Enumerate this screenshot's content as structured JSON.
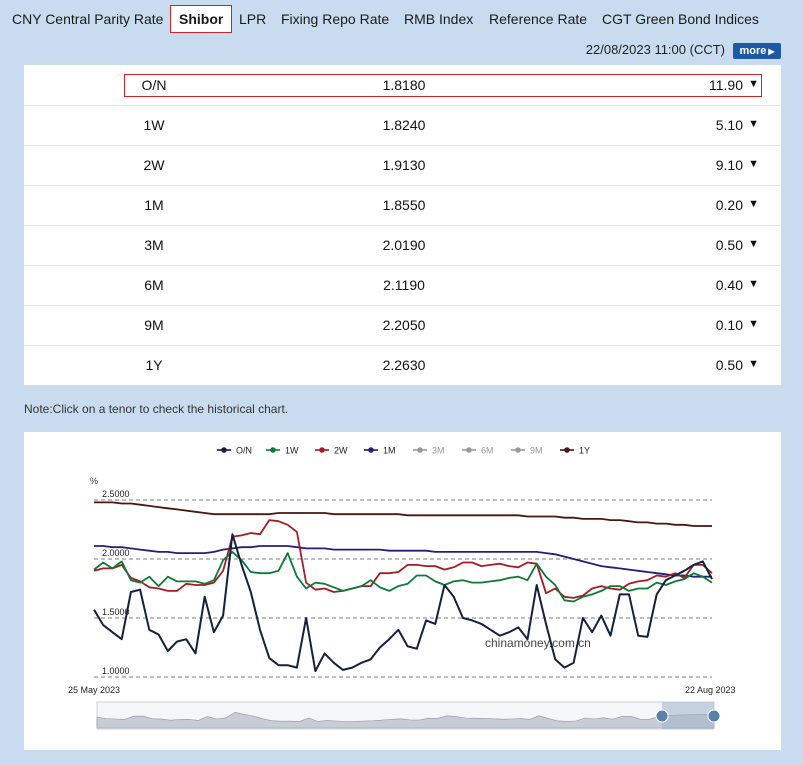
{
  "tabs": [
    {
      "label": "CNY Central Parity Rate",
      "active": false
    },
    {
      "label": "Shibor",
      "active": true
    },
    {
      "label": "LPR",
      "active": false
    },
    {
      "label": "Fixing Repo Rate",
      "active": false
    },
    {
      "label": "RMB Index",
      "active": false
    },
    {
      "label": "Reference Rate",
      "active": false
    },
    {
      "label": "CGT Green Bond Indices",
      "active": false
    }
  ],
  "header": {
    "timestamp": "22/08/2023 11:00 (CCT)",
    "more_label": "more"
  },
  "rates": [
    {
      "tenor": "O/N",
      "rate": "1.8180",
      "change": "11.90",
      "direction": "down",
      "selected": true
    },
    {
      "tenor": "1W",
      "rate": "1.8240",
      "change": "5.10",
      "direction": "down",
      "selected": false
    },
    {
      "tenor": "2W",
      "rate": "1.9130",
      "change": "9.10",
      "direction": "down",
      "selected": false
    },
    {
      "tenor": "1M",
      "rate": "1.8550",
      "change": "0.20",
      "direction": "down",
      "selected": false
    },
    {
      "tenor": "3M",
      "rate": "2.0190",
      "change": "0.50",
      "direction": "down",
      "selected": false
    },
    {
      "tenor": "6M",
      "rate": "2.1190",
      "change": "0.40",
      "direction": "down",
      "selected": false
    },
    {
      "tenor": "9M",
      "rate": "2.2050",
      "change": "0.10",
      "direction": "down",
      "selected": false
    },
    {
      "tenor": "1Y",
      "rate": "2.2630",
      "change": "0.50",
      "direction": "down",
      "selected": false
    }
  ],
  "note": "Note:Click on a tenor to check the historical chart.",
  "watermark": "chinamoney.com.cn",
  "chart_data": {
    "type": "line",
    "ylabel": "%",
    "ylim": [
      1.0,
      2.5
    ],
    "yticks": [
      "2.5000",
      "2.0000",
      "1.5000",
      "1.0000"
    ],
    "x_start_label": "25 May 2023",
    "x_end_label": "22 Aug 2023",
    "grid": true,
    "legend_position": "top-center",
    "legend": [
      {
        "name": "O/N",
        "color": "#13213f",
        "active": true
      },
      {
        "name": "1W",
        "color": "#0e7a3a",
        "active": true
      },
      {
        "name": "2W",
        "color": "#a51d22",
        "active": true
      },
      {
        "name": "1M",
        "color": "#221f7a",
        "active": true
      },
      {
        "name": "3M",
        "color": "#9a9a9a",
        "active": false
      },
      {
        "name": "6M",
        "color": "#9a9a9a",
        "active": false
      },
      {
        "name": "9M",
        "color": "#9a9a9a",
        "active": false
      },
      {
        "name": "1Y",
        "color": "#4a1610",
        "active": true
      }
    ],
    "series": [
      {
        "name": "O/N",
        "color": "#13213f",
        "values": [
          1.57,
          1.44,
          1.38,
          1.32,
          1.72,
          1.74,
          1.4,
          1.36,
          1.22,
          1.3,
          1.32,
          1.2,
          1.68,
          1.38,
          1.52,
          2.21,
          1.95,
          1.72,
          1.4,
          1.16,
          1.1,
          1.1,
          1.08,
          1.5,
          1.05,
          1.2,
          1.12,
          1.06,
          1.08,
          1.12,
          1.15,
          1.25,
          1.32,
          1.4,
          1.26,
          1.24,
          1.48,
          1.45,
          1.78,
          1.68,
          1.5,
          1.48,
          1.45,
          1.4,
          1.35,
          1.38,
          1.42,
          1.32,
          1.78,
          1.45,
          1.15,
          1.08,
          1.12,
          1.5,
          1.38,
          1.52,
          1.35,
          1.7,
          1.7,
          1.35,
          1.34,
          1.7,
          1.82,
          1.86,
          1.9,
          1.95,
          1.98,
          1.83
        ]
      },
      {
        "name": "1W",
        "color": "#0e7a3a",
        "values": [
          1.91,
          1.97,
          1.92,
          1.98,
          1.82,
          1.8,
          1.85,
          1.77,
          1.85,
          1.81,
          1.81,
          1.81,
          1.79,
          1.82,
          1.99,
          2.06,
          1.99,
          1.89,
          1.88,
          1.88,
          1.9,
          2.05,
          1.85,
          1.75,
          1.8,
          1.79,
          1.76,
          1.73,
          1.75,
          1.77,
          1.82,
          1.76,
          1.73,
          1.77,
          1.79,
          1.86,
          1.86,
          1.81,
          1.78,
          1.81,
          1.82,
          1.8,
          1.8,
          1.81,
          1.82,
          1.84,
          1.85,
          1.82,
          1.96,
          1.85,
          1.78,
          1.65,
          1.64,
          1.68,
          1.7,
          1.73,
          1.77,
          1.77,
          1.73,
          1.75,
          1.75,
          1.8,
          1.78,
          1.81,
          1.83,
          1.88,
          1.85,
          1.8
        ]
      },
      {
        "name": "2W",
        "color": "#a51d22",
        "values": [
          1.9,
          1.92,
          1.92,
          1.95,
          1.84,
          1.81,
          1.76,
          1.75,
          1.73,
          1.73,
          1.79,
          1.78,
          1.78,
          1.8,
          1.9,
          2.19,
          2.2,
          2.22,
          2.21,
          2.33,
          2.32,
          2.29,
          2.23,
          1.8,
          1.74,
          1.75,
          1.72,
          1.73,
          1.75,
          1.77,
          1.77,
          1.88,
          1.88,
          1.89,
          1.95,
          1.95,
          1.94,
          1.94,
          1.91,
          1.93,
          1.97,
          1.97,
          1.94,
          1.95,
          1.96,
          1.94,
          1.93,
          1.97,
          1.96,
          1.71,
          1.75,
          1.68,
          1.67,
          1.69,
          1.75,
          1.77,
          1.75,
          1.74,
          1.79,
          1.81,
          1.82,
          1.86,
          1.85,
          1.88,
          1.84,
          1.95,
          1.95,
          1.88
        ]
      },
      {
        "name": "1M",
        "color": "#221f7a",
        "values": [
          2.11,
          2.11,
          2.1,
          2.1,
          2.09,
          2.08,
          2.07,
          2.06,
          2.06,
          2.05,
          2.05,
          2.05,
          2.05,
          2.06,
          2.08,
          2.09,
          2.1,
          2.1,
          2.11,
          2.11,
          2.11,
          2.11,
          2.1,
          2.09,
          2.09,
          2.09,
          2.08,
          2.08,
          2.08,
          2.08,
          2.08,
          2.08,
          2.07,
          2.07,
          2.07,
          2.07,
          2.07,
          2.06,
          2.06,
          2.06,
          2.06,
          2.06,
          2.06,
          2.06,
          2.06,
          2.06,
          2.06,
          2.06,
          2.06,
          2.05,
          2.04,
          2.02,
          2.0,
          1.98,
          1.96,
          1.94,
          1.93,
          1.92,
          1.91,
          1.9,
          1.89,
          1.88,
          1.87,
          1.86,
          1.86,
          1.85,
          1.85,
          1.85
        ]
      },
      {
        "name": "1Y",
        "color": "#4a1610",
        "values": [
          2.48,
          2.48,
          2.48,
          2.47,
          2.47,
          2.46,
          2.45,
          2.44,
          2.43,
          2.42,
          2.41,
          2.4,
          2.39,
          2.38,
          2.38,
          2.38,
          2.38,
          2.38,
          2.38,
          2.38,
          2.39,
          2.39,
          2.39,
          2.39,
          2.39,
          2.39,
          2.38,
          2.38,
          2.38,
          2.38,
          2.38,
          2.38,
          2.38,
          2.38,
          2.37,
          2.37,
          2.37,
          2.37,
          2.37,
          2.37,
          2.37,
          2.37,
          2.37,
          2.37,
          2.37,
          2.37,
          2.37,
          2.36,
          2.36,
          2.36,
          2.36,
          2.35,
          2.35,
          2.34,
          2.34,
          2.34,
          2.33,
          2.33,
          2.32,
          2.31,
          2.31,
          2.3,
          2.3,
          2.29,
          2.29,
          2.28,
          2.28,
          2.28
        ]
      }
    ]
  }
}
